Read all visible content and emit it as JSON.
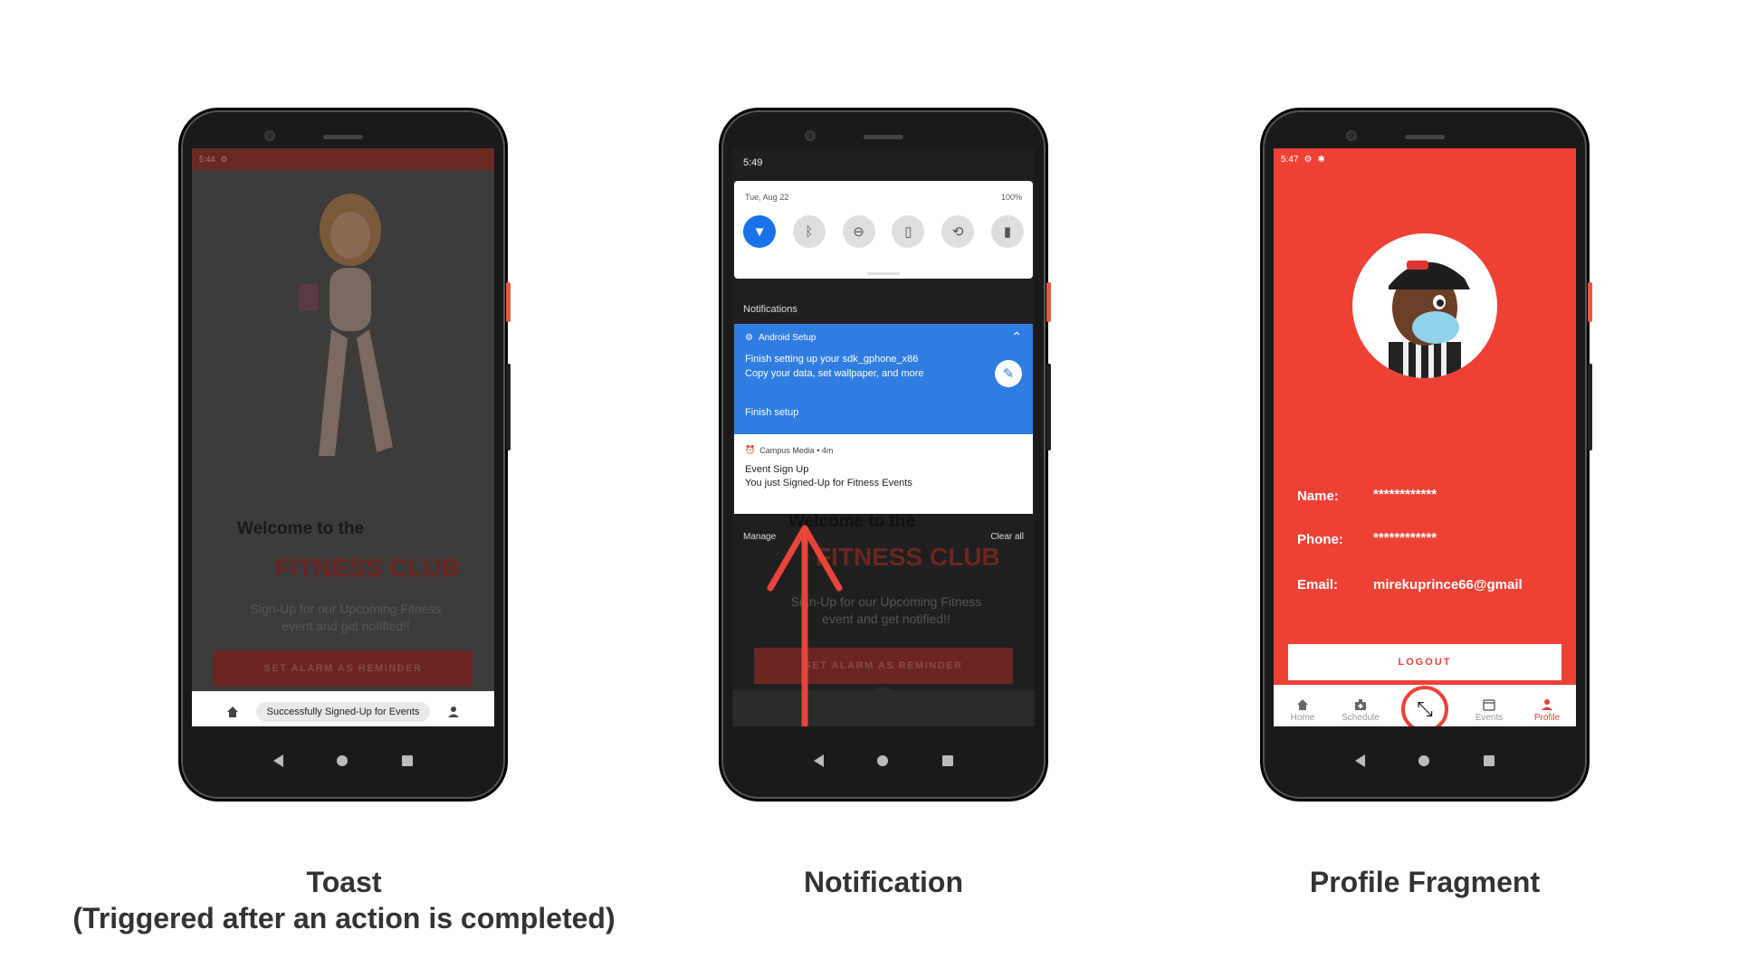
{
  "toast_phone": {
    "status_time": "5:44",
    "welcome": "Welcome to the",
    "club": "FITNESS CLUB",
    "subtitle_line1": "Sign-Up for our Upcoming Fitness",
    "subtitle_line2": "event and get notified!!",
    "alarm_button": "SET ALARM AS REMINDER",
    "toast_message": "Successfully Signed-Up for Events",
    "caption_line1": "Toast",
    "caption_line2": "(Triggered after an action is completed)"
  },
  "notification_phone": {
    "status_time": "5:49",
    "date": "Tue, Aug 22",
    "battery": "100%",
    "notifications_header": "Notifications",
    "setup_app": "Android Setup",
    "setup_line1": "Finish setting up your sdk_gphone_x86",
    "setup_line2": "Copy your data, set wallpaper, and more",
    "setup_action": "Finish setup",
    "event_app": "Campus Media • 4m",
    "event_title": "Event Sign Up",
    "event_body": "You just Signed-Up for Fitness Events",
    "manage": "Manage",
    "clear_all": "Clear all",
    "welcome": "Welcome to the",
    "club": "FITNESS CLUB",
    "subtitle_line1": "Sign-Up for our Upcoming Fitness",
    "subtitle_line2": "event and get notified!!",
    "alarm_button": "SET ALARM AS REMINDER",
    "caption": "Notification"
  },
  "profile_phone": {
    "status_time": "5:47",
    "name_label": "Name:",
    "name_value": "************",
    "phone_label": "Phone:",
    "phone_value": "************",
    "email_label": "Email:",
    "email_value": "mirekuprince66@gmail",
    "logout": "LOGOUT",
    "nav_home": "Home",
    "nav_schedule": "Schedule",
    "nav_events": "Events",
    "nav_profile": "Profile",
    "caption": "Profile Fragment"
  },
  "colors": {
    "brand_red": "#ee4136",
    "notification_blue": "#2f7de1",
    "arrow_red": "#e8443a"
  }
}
